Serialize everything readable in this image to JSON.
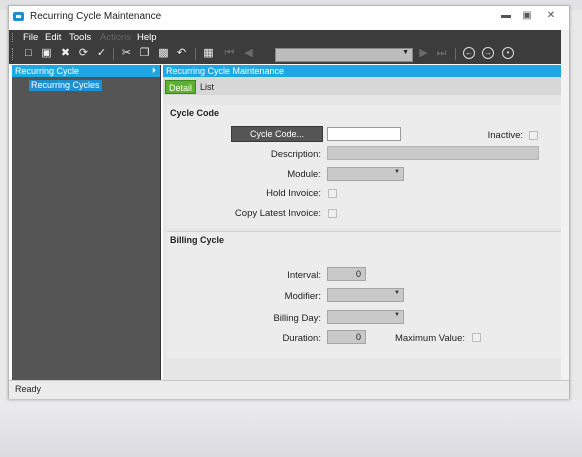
{
  "window": {
    "title": "Recurring Cycle Maintenance"
  },
  "menu": {
    "items": [
      "File",
      "Edit",
      "Tools",
      "Actions",
      "Help"
    ]
  },
  "toolbar": {
    "icons": [
      "new-icon",
      "save-icon",
      "delete-icon",
      "refresh-icon",
      "clear-icon",
      "cut-icon",
      "copy-icon",
      "paste-icon",
      "undo-icon",
      "binoculars-icon",
      "first-record-icon",
      "previous-record-icon",
      "next-record-icon",
      "last-record-icon",
      "back-icon",
      "forward-icon",
      "home-icon"
    ],
    "nav_select_value": ""
  },
  "left_pane": {
    "header": "Recurring Cycle",
    "tree_items": [
      "Recurring Cycles"
    ]
  },
  "main_pane": {
    "header": "Recurring Cycle Maintenance",
    "tabs": [
      "Detail",
      "List"
    ],
    "active_tab": "Detail"
  },
  "cycle_code_section": {
    "title": "Cycle Code",
    "cycle_code_button": "Cycle Code...",
    "cycle_code_value": "",
    "inactive_label": "Inactive:",
    "description_label": "Description:",
    "description_value": "",
    "module_label": "Module:",
    "module_value": "",
    "hold_invoice_label": "Hold Invoice:",
    "copy_latest_invoice_label": "Copy Latest Invoice:"
  },
  "billing_cycle_section": {
    "title": "Billing Cycle",
    "interval_label": "Interval:",
    "interval_value": "0",
    "modifier_label": "Modifier:",
    "modifier_value": "",
    "billing_day_label": "Billing Day:",
    "billing_day_value": "",
    "duration_label": "Duration:",
    "duration_value": "0",
    "maximum_value_label": "Maximum Value:"
  },
  "status": {
    "text": "Ready"
  },
  "colors": {
    "accent_blue": "#1ea8e3",
    "active_tab_green": "#5db030",
    "toolbar_dark": "#3c3c3c"
  }
}
